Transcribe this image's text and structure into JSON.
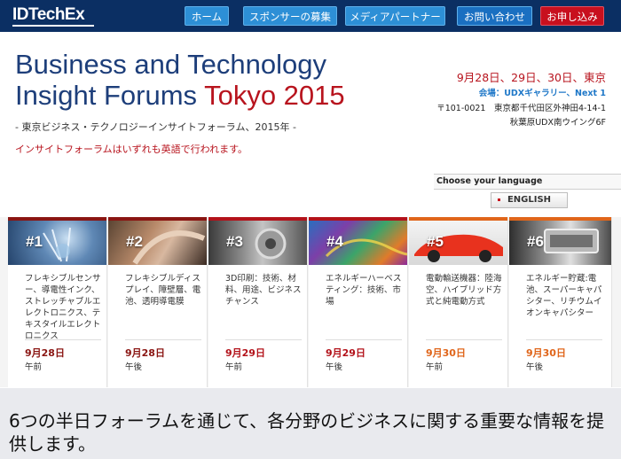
{
  "header": {
    "logo_text": "IDTechEx",
    "nav": [
      {
        "label": "ホーム"
      },
      {
        "label": "スポンサーの募集"
      },
      {
        "label": "メディアパートナー"
      },
      {
        "label": "お問い合わせ"
      },
      {
        "label": "お申し込み"
      }
    ],
    "colors": {
      "bar": "#0b2f63",
      "nav_button": "#2d8fd6",
      "apply_button": "#c8101e"
    }
  },
  "hero": {
    "title_line1": "Business and Technology",
    "title_line2_prefix": "Insight Forums ",
    "title_line2_city": "Tokyo 2015",
    "subtitle": "- 東京ビジネス・テクノロジーインサイトフォーラム、2015年 -",
    "note": "インサイトフォーラムはいずれも英語で行われます。"
  },
  "event": {
    "dates": "9月28日、29日、30日、東京",
    "venue": "会場：UDXギャラリー、Next 1",
    "address_line1": "〒101-0021　東京都千代田区外神田4-14-1",
    "address_line2": "秋葉原UDX南ウイング6F"
  },
  "language": {
    "label": "Choose your language",
    "button": "ENGLISH"
  },
  "forums": [
    {
      "num": "#1",
      "desc": "フレキシブルセンサー、導電性インク、ストレッチャブルエレクトロニクス、テキスタイルエレクトロニクス",
      "date": "9月28日",
      "time": "午前",
      "accent": "#8a1512"
    },
    {
      "num": "#2",
      "desc": "フレキシブルディスプレイ、障壁層、電池、透明導電膜",
      "date": "9月28日",
      "time": "午後",
      "accent": "#8a1512"
    },
    {
      "num": "#3",
      "desc": "3D印刷：技術、材料、用途、ビジネスチャンス",
      "date": "9月29日",
      "time": "午前",
      "accent": "#b3121a"
    },
    {
      "num": "#4",
      "desc": "エネルギーハーベスティング：技術、市場",
      "date": "9月29日",
      "time": "午後",
      "accent": "#b3121a"
    },
    {
      "num": "#5",
      "desc": "電動輸送機器：陸海空、ハイブリッド方式と純電動方式",
      "date": "9月30日",
      "time": "午前",
      "accent": "#e0651a"
    },
    {
      "num": "#6",
      "desc": "エネルギー貯蔵:電池、スーパーキャパシター、リチウムイオンキャパシター",
      "date": "9月30日",
      "time": "午後",
      "accent": "#e0651a"
    }
  ],
  "bottom": {
    "text": "6つの半日フォーラムを通じて、各分野のビジネスに関する重要な情報を提供します。"
  }
}
